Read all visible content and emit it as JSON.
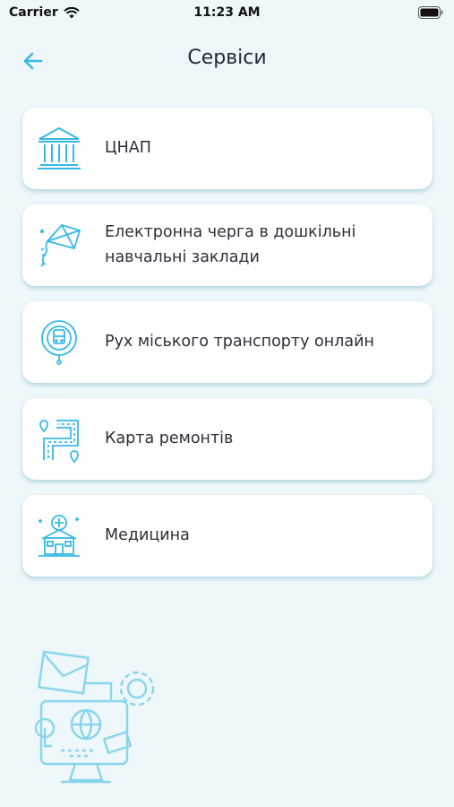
{
  "status_bar": {
    "carrier": "Carrier",
    "time": "11:23 AM"
  },
  "header": {
    "title": "Сервіси"
  },
  "services": [
    {
      "label": "ЦНАП",
      "icon": "government-building-icon"
    },
    {
      "label": "Електронна черга в дошкільні навчальні заклади",
      "icon": "kite-icon"
    },
    {
      "label": "Рух міського транспорту онлайн",
      "icon": "transport-tracking-icon"
    },
    {
      "label": "Карта ремонтів",
      "icon": "road-map-icon"
    },
    {
      "label": "Медицина",
      "icon": "hospital-icon"
    }
  ],
  "colors": {
    "accent": "#37b9e6",
    "background": "#eef7f9",
    "card": "#ffffff",
    "text": "#2b3038"
  }
}
